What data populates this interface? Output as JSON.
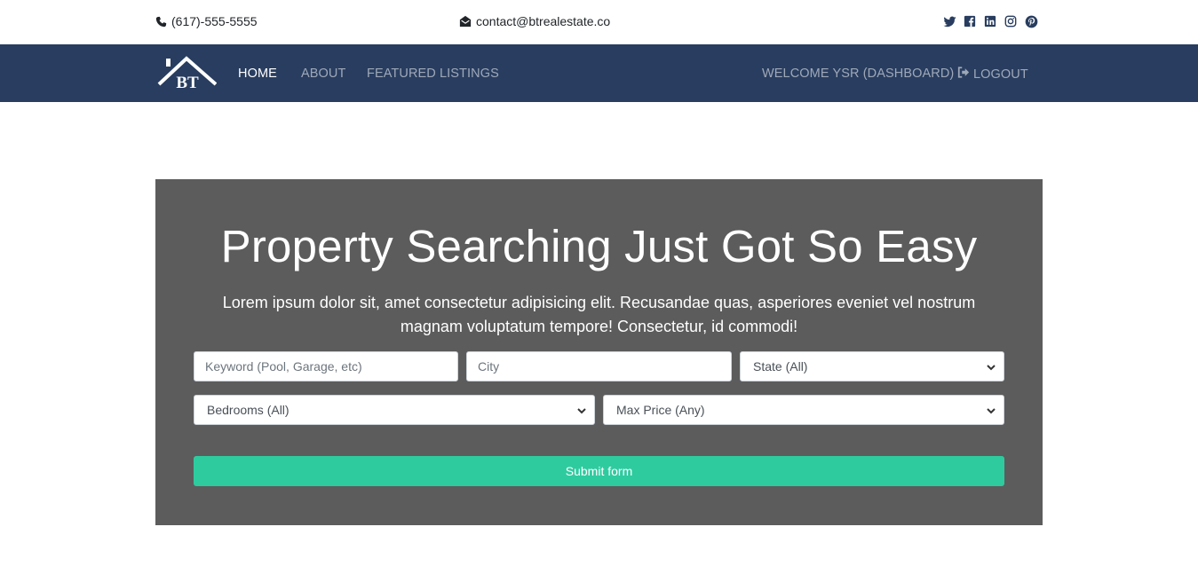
{
  "topbar": {
    "phone": "(617)-555-5555",
    "email": "contact@btrealestate.co",
    "social_icons": [
      "twitter-icon",
      "facebook-icon",
      "linkedin-icon",
      "instagram-icon",
      "pinterest-icon"
    ]
  },
  "navbar": {
    "logo_text": "BT",
    "links": {
      "home": "HOME",
      "about": "ABOUT",
      "featured": "FEATURED LISTINGS"
    },
    "welcome": "WELCOME YSR (DASHBOARD)",
    "logout": "LOGOUT"
  },
  "hero": {
    "title": "Property Searching Just Got So Easy",
    "text": "Lorem ipsum dolor sit, amet consectetur adipisicing elit. Recusandae quas, asperiores eveniet vel nostrum magnam voluptatum tempore! Consectetur, id commodi!"
  },
  "form": {
    "keyword_placeholder": "Keyword (Pool, Garage, etc)",
    "city_placeholder": "City",
    "state_selected": "State (All)",
    "bedrooms_selected": "Bedrooms (All)",
    "price_selected": "Max Price (Any)",
    "submit_label": "Submit form"
  },
  "colors": {
    "navbar": "#283d5f",
    "hero_bg": "#5c5c5c",
    "submit": "#2ecb9f"
  }
}
